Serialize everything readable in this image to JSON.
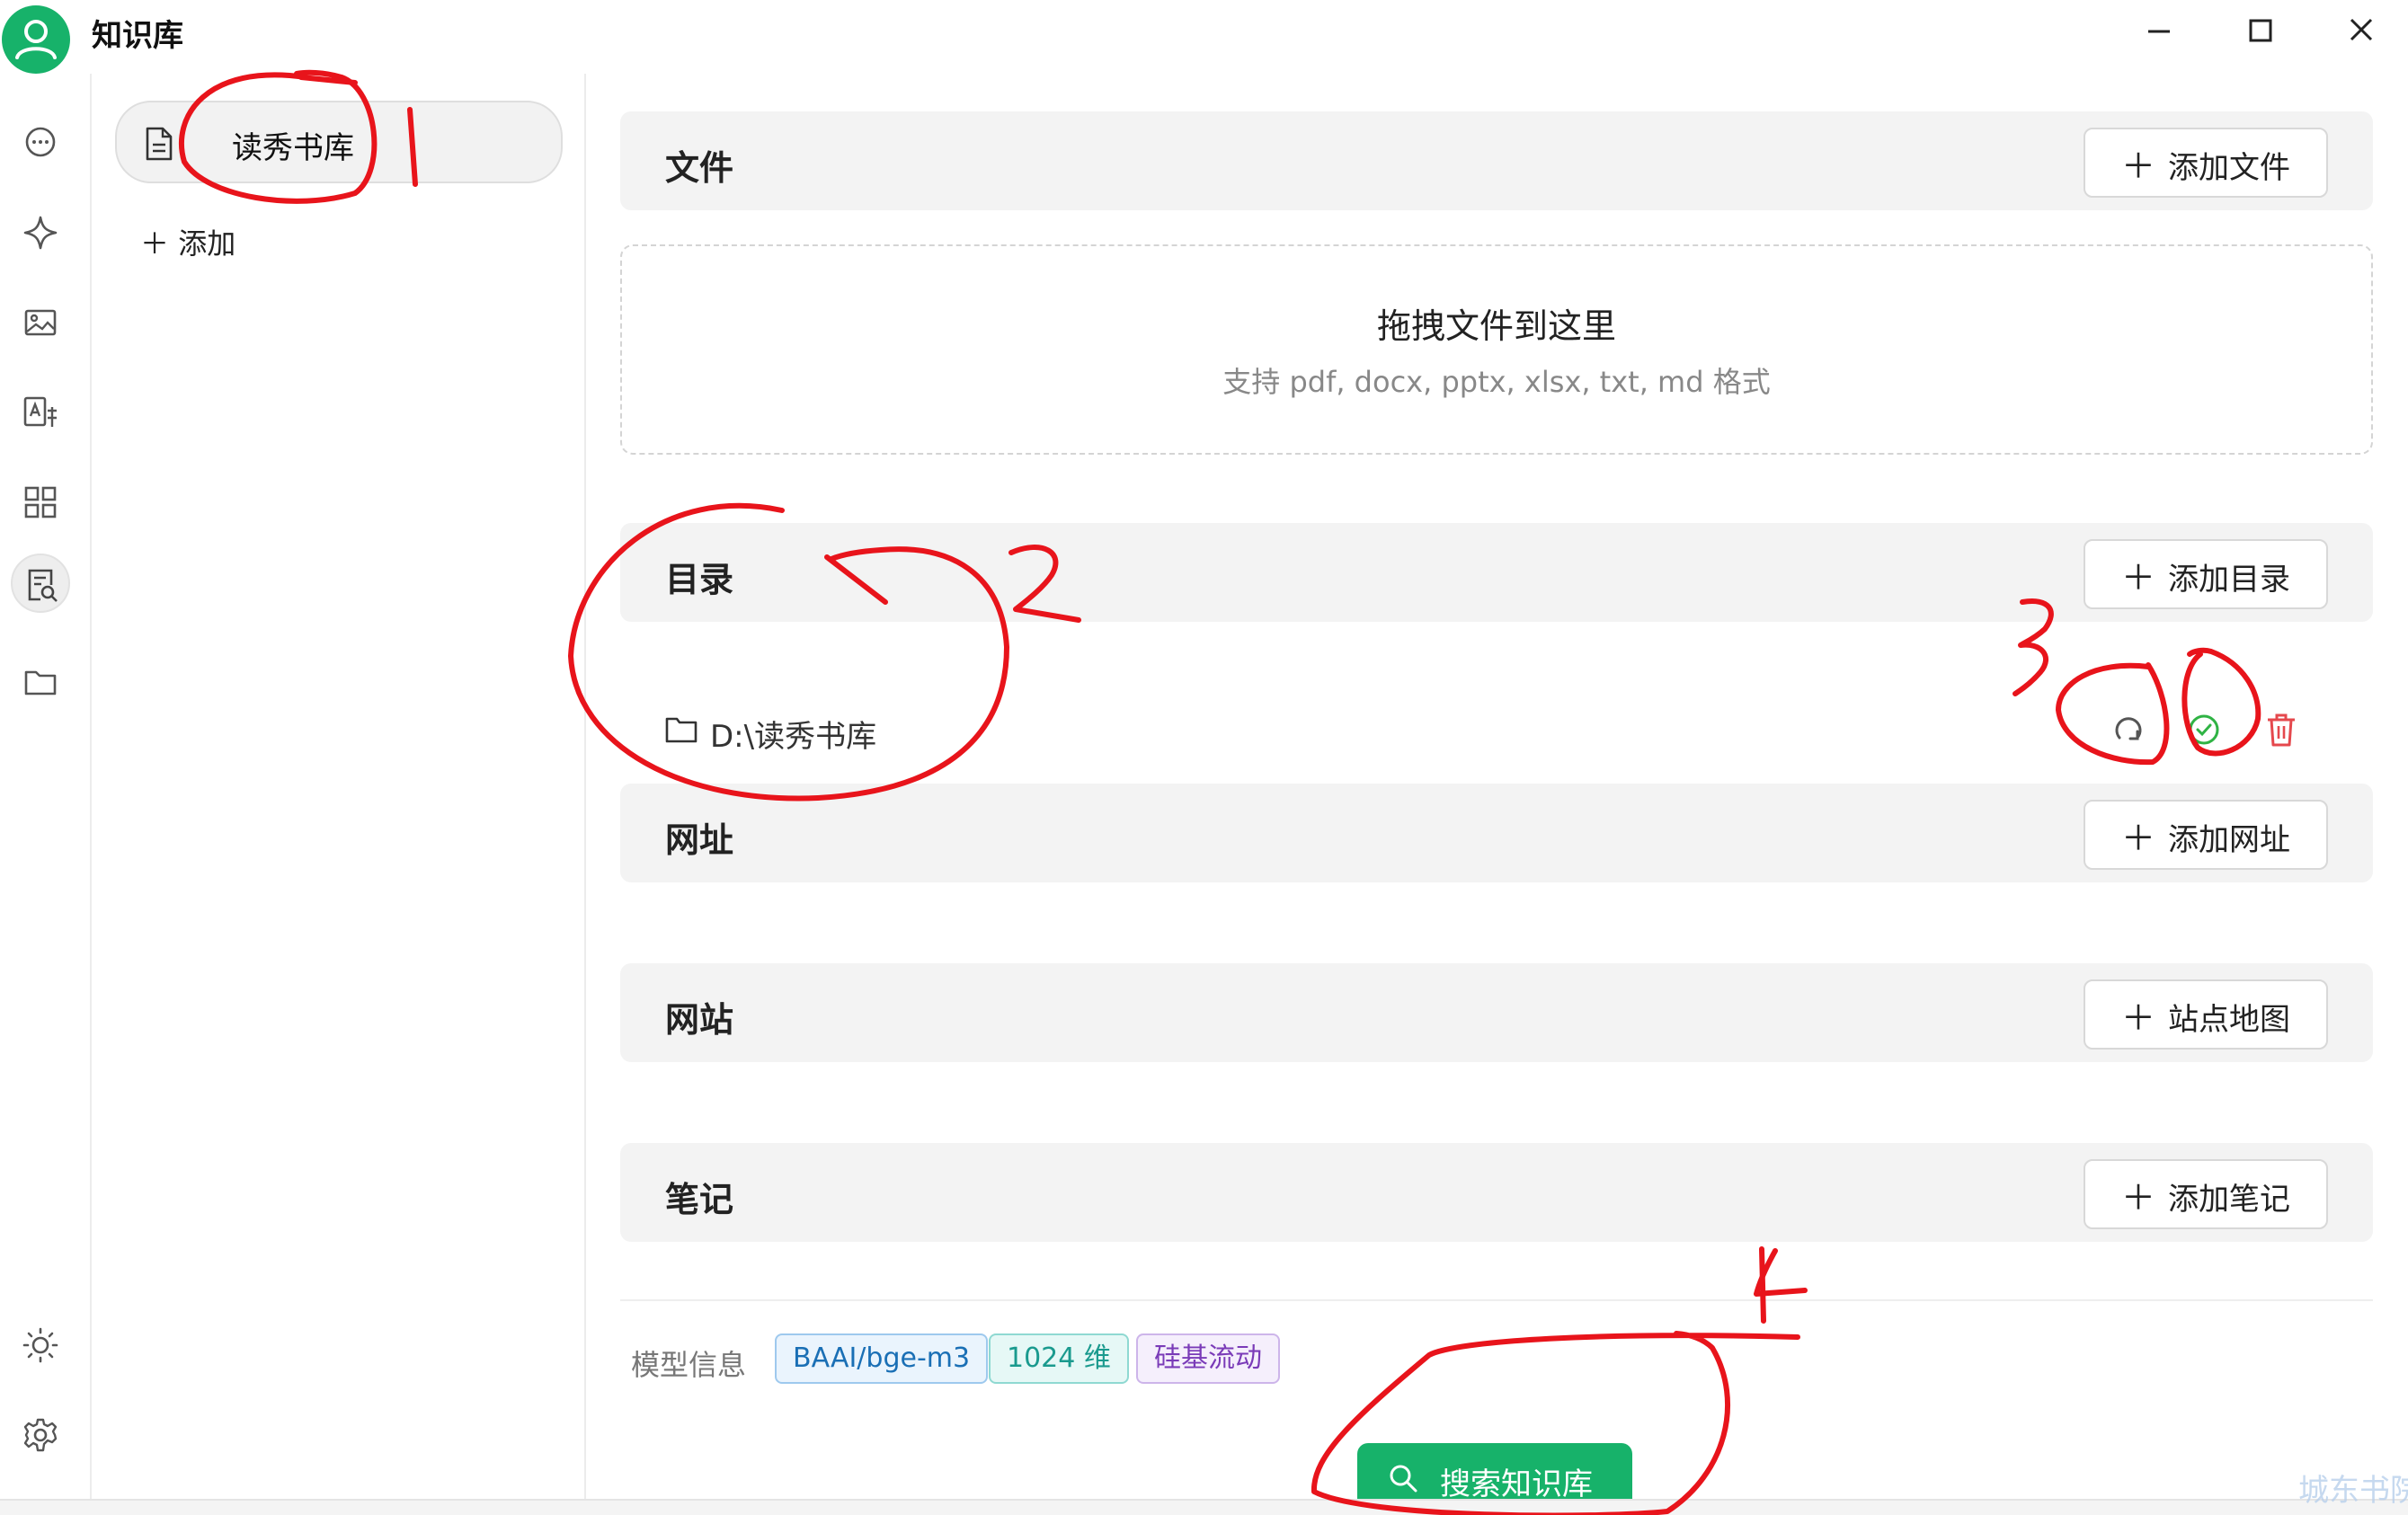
{
  "window": {
    "title": "知识库"
  },
  "knowledge_bases": {
    "items": [
      {
        "label": "读秀书库"
      }
    ],
    "add_label": "添加"
  },
  "sections": {
    "files": {
      "title": "文件",
      "button": "添加文件"
    },
    "dropzone": {
      "title": "拖拽文件到这里",
      "subtitle": "支持 pdf, docx, pptx, xlsx, txt, md 格式"
    },
    "directory": {
      "title": "目录",
      "button": "添加目录",
      "items": [
        {
          "path": "D:\\读秀书库"
        }
      ]
    },
    "url": {
      "title": "网址",
      "button": "添加网址"
    },
    "website": {
      "title": "网站",
      "button": "站点地图"
    },
    "notes": {
      "title": "笔记",
      "button": "添加笔记"
    }
  },
  "model_info": {
    "label": "模型信息",
    "tags": [
      "BAAI/bge-m3",
      "1024 维",
      "硅基流动"
    ]
  },
  "search_button": "搜索知识库",
  "annotations": [
    "1",
    "2",
    "3",
    "4"
  ],
  "colors": {
    "accent": "#17b26a",
    "danger": "#e5484d",
    "annotation": "#e8141b"
  },
  "icons": {
    "rail": [
      "chat-icon",
      "sparkle-icon",
      "image-icon",
      "translate-icon",
      "apps-grid-icon",
      "knowledge-icon",
      "folder-icon",
      "sun-icon",
      "gear-icon"
    ]
  }
}
